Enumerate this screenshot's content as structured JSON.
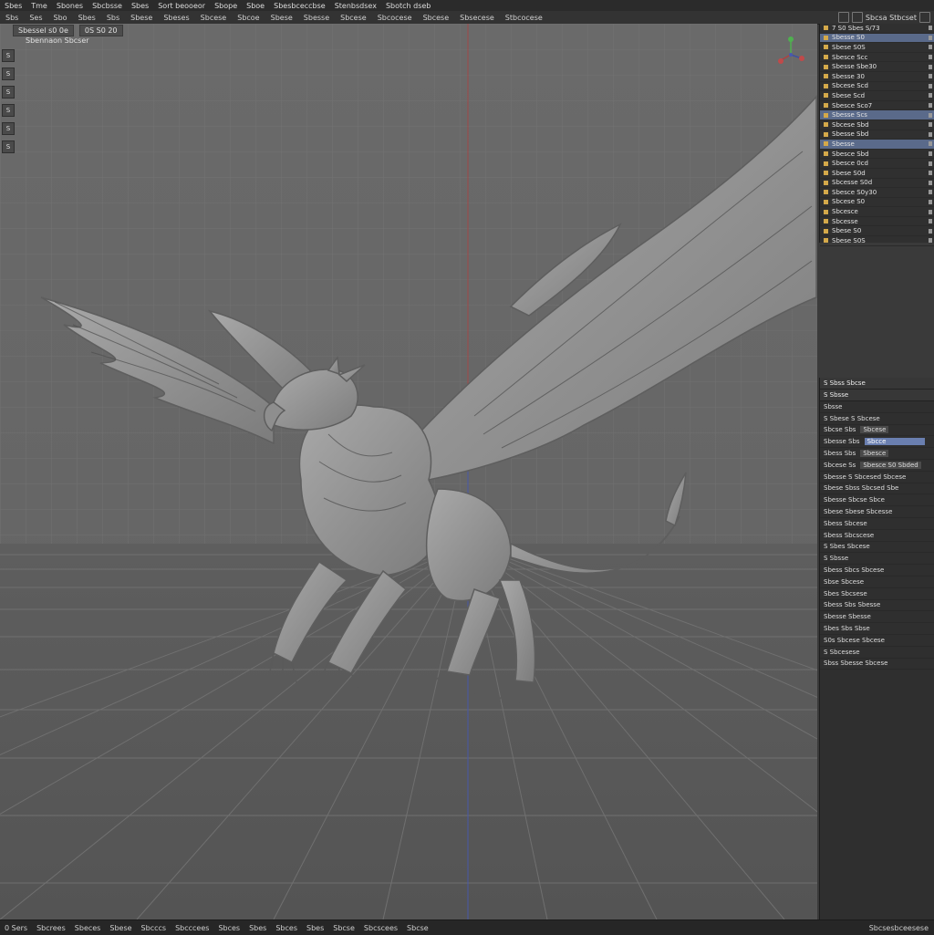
{
  "menubar": [
    "Sbes",
    "Tme",
    "Sbones",
    "Sbcbsse",
    "Sbes",
    "Sort beooeor",
    "Sbope",
    "Sboe",
    "Sbesbceccbse",
    "Stenbsdsex",
    "Sbotch dseb"
  ],
  "toolbar": [
    "Sbs",
    "Ses",
    "Sbo",
    "Sbes",
    "Sbs",
    "Sbese",
    "Sbeses",
    "Sbcese",
    "Sbcoe",
    "Sbese",
    "Sbesse",
    "Sbcese",
    "Sbcocese",
    "Sbcese",
    "Sbsecese",
    "Stbcocese"
  ],
  "toolbar_right_label": "Sbcsa  Stbcset",
  "viewport": {
    "header": [
      "Sbessel s0 0e",
      "0S  S0 20"
    ],
    "sub": "Sbennaon   Sbcser",
    "left_tools": [
      "S",
      "S",
      "S",
      "S",
      "S",
      "S"
    ]
  },
  "outliner": {
    "rows": [
      {
        "label": "7 S0 Sbes S/73",
        "sel": false
      },
      {
        "label": "Sbesse S0",
        "sel": true
      },
      {
        "label": "Sbese  S0S",
        "sel": false
      },
      {
        "label": "Sbesce  Scc",
        "sel": false
      },
      {
        "label": "Sbesse Sbe30",
        "sel": false
      },
      {
        "label": "Sbesse 30",
        "sel": false
      },
      {
        "label": "Sbcese  Scd",
        "sel": false
      },
      {
        "label": "Sbese  Scd",
        "sel": false
      },
      {
        "label": "Sbesce  Sco7",
        "sel": false
      },
      {
        "label": "Sbesse Scs",
        "sel": true
      },
      {
        "label": "Sbcese  Sbd",
        "sel": false
      },
      {
        "label": "Sbesse  Sbd",
        "sel": false
      },
      {
        "label": "Sbesse",
        "sel": true
      },
      {
        "label": "Sbesce  Sbd",
        "sel": false
      },
      {
        "label": "Sbesce  0cd",
        "sel": false
      },
      {
        "label": "Sbese  S0d",
        "sel": false
      },
      {
        "label": "Sbcesse  S0d",
        "sel": false
      },
      {
        "label": "Sbesce S0y30",
        "sel": false
      },
      {
        "label": "Sbcese  S0",
        "sel": false
      },
      {
        "label": "Sbcesce",
        "sel": false
      },
      {
        "label": "Sbcesse",
        "sel": false
      },
      {
        "label": "Sbese  S0",
        "sel": false
      },
      {
        "label": "Sbese S0S",
        "sel": false
      }
    ]
  },
  "properties": {
    "header": "S  Sbss Sbcse",
    "sub": "S  Sbsse",
    "rows": [
      {
        "a": "Sbsse",
        "b": "",
        "sel": false
      },
      {
        "a": "S  Sbese  S Sbcese",
        "b": "",
        "sel": false
      },
      {
        "a": "Sbcse  Sbs",
        "b": "Sbcese",
        "sel": false
      },
      {
        "a": "Sbesse  Sbs",
        "b": "Sbcce",
        "sel": true
      },
      {
        "a": "Sbess  Sbs",
        "b": "Sbesce",
        "sel": false
      },
      {
        "a": "Sbcese  Ss",
        "b": "Sbesce S0 Sbded",
        "sel": false
      },
      {
        "a": "Sbesse S  Sbcesed Sbcese",
        "b": "",
        "sel": false
      },
      {
        "a": "Sbese Sbss  Sbcsed Sbe",
        "b": "",
        "sel": false
      },
      {
        "a": "Sbesse  Sbcse  Sbce",
        "b": "",
        "sel": false
      },
      {
        "a": "Sbese  Sbese  Sbcesse",
        "b": "",
        "sel": false
      },
      {
        "a": "Sbess  Sbcese",
        "b": "",
        "sel": false
      },
      {
        "a": "Sbess  Sbcscese",
        "b": "",
        "sel": false
      },
      {
        "a": "S  Sbes  Sbcese",
        "b": "",
        "sel": false
      },
      {
        "a": "S  Sbsse",
        "b": "",
        "sel": false
      },
      {
        "a": "Sbess  Sbcs  Sbcese",
        "b": "",
        "sel": false
      },
      {
        "a": "Sbse  Sbcese",
        "b": "",
        "sel": false
      },
      {
        "a": "Sbes  Sbcsese",
        "b": "",
        "sel": false
      },
      {
        "a": "Sbess Sbs Sbesse",
        "b": "",
        "sel": false
      },
      {
        "a": "Sbesse  Sbesse",
        "b": "",
        "sel": false
      },
      {
        "a": "Sbes  Sbs Sbse",
        "b": "",
        "sel": false
      },
      {
        "a": "S0s  Sbcese  Sbcese",
        "b": "",
        "sel": false
      },
      {
        "a": "S  Sbcesese",
        "b": "",
        "sel": false
      },
      {
        "a": "Sbss  Sbesse  Sbcese",
        "b": "",
        "sel": false
      }
    ]
  },
  "statusbar": [
    "0 Sers",
    "Sbcrees",
    "Sbeces",
    "Sbese",
    "Sbcccs",
    "Sbcccees",
    "Sbces",
    "Sbes",
    "Sbces",
    "Sbes",
    "Sbcse",
    "Sbcscees",
    "Sbcse"
  ],
  "statusbar_right": "Sbcsesbceesese",
  "colors": {
    "axis_red": "#b04040",
    "axis_blue": "#4050a0",
    "gizmo_green": "#4fb04f",
    "accent_sel": "#5a6a8a"
  }
}
